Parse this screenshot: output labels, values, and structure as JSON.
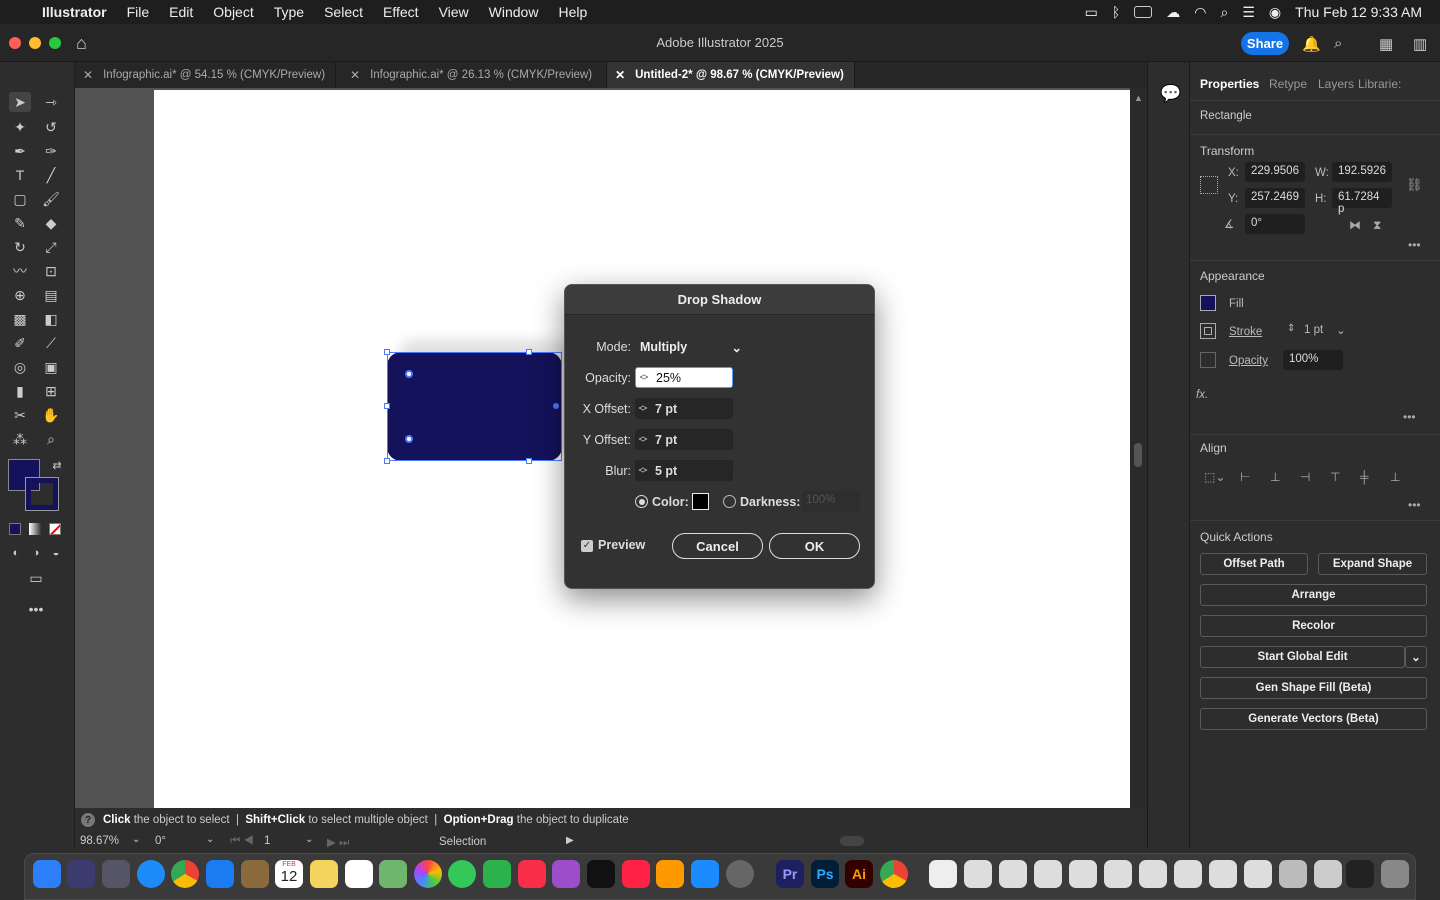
{
  "menubar": {
    "app": "Illustrator",
    "items": [
      "File",
      "Edit",
      "Object",
      "Type",
      "Select",
      "Effect",
      "View",
      "Window",
      "Help"
    ],
    "clock": "Thu Feb 12  9:33 AM"
  },
  "titlebar": {
    "title": "Adobe Illustrator 2025",
    "share": "Share"
  },
  "tabs": [
    {
      "label": "Infographic.ai* @ 54.15 % (CMYK/Preview)"
    },
    {
      "label": "Infographic.ai* @ 26.13 % (CMYK/Preview)"
    },
    {
      "label": "Untitled-2* @ 98.67 % (CMYK/Preview)"
    }
  ],
  "status": {
    "p1b": "Click",
    "p1": " the object to select  |  ",
    "p2b": "Shift+Click",
    "p2": " to select multiple object  |  ",
    "p3b": "Option+Drag",
    "p3": " the object to duplicate"
  },
  "bottom": {
    "zoom": "98.67%",
    "rotation": "0°",
    "artboard": "1",
    "tool": "Selection"
  },
  "panel": {
    "tabs": [
      "Properties",
      "Retype",
      "Layers",
      "Librarie:"
    ],
    "object": "Rectangle",
    "transform": {
      "title": "Transform",
      "x_label": "X:",
      "x": "229.9506",
      "y_label": "Y:",
      "y": "257.2469",
      "w_label": "W:",
      "w": "192.5926",
      "h_label": "H:",
      "h": "61.7284 p",
      "angle": "0°"
    },
    "appearance": {
      "title": "Appearance",
      "fill": "Fill",
      "stroke": "Stroke",
      "stroke_val": "1 pt",
      "opacity": "Opacity",
      "opacity_val": "100%",
      "fx": "fx."
    },
    "align": {
      "title": "Align"
    },
    "quick": {
      "title": "Quick Actions",
      "offset": "Offset Path",
      "expand": "Expand Shape",
      "arrange": "Arrange",
      "recolor": "Recolor",
      "global": "Start Global Edit",
      "genfill": "Gen Shape Fill (Beta)",
      "genvec": "Generate Vectors (Beta)"
    }
  },
  "dialog": {
    "title": "Drop Shadow",
    "mode_label": "Mode:",
    "mode": "Multiply",
    "opacity_label": "Opacity:",
    "opacity": "25%",
    "x_label": "X Offset:",
    "x": "7 pt",
    "y_label": "Y Offset:",
    "y": "7 pt",
    "blur_label": "Blur:",
    "blur": "5 pt",
    "color_label": "Color:",
    "darkness_label": "Darkness:",
    "darkness": "100%",
    "preview": "Preview",
    "cancel": "Cancel",
    "ok": "OK"
  },
  "colors": {
    "fill": "#14125a",
    "accent": "#1473e6"
  },
  "dock": {
    "calendar_month": "FEB",
    "calendar_day": "12"
  }
}
